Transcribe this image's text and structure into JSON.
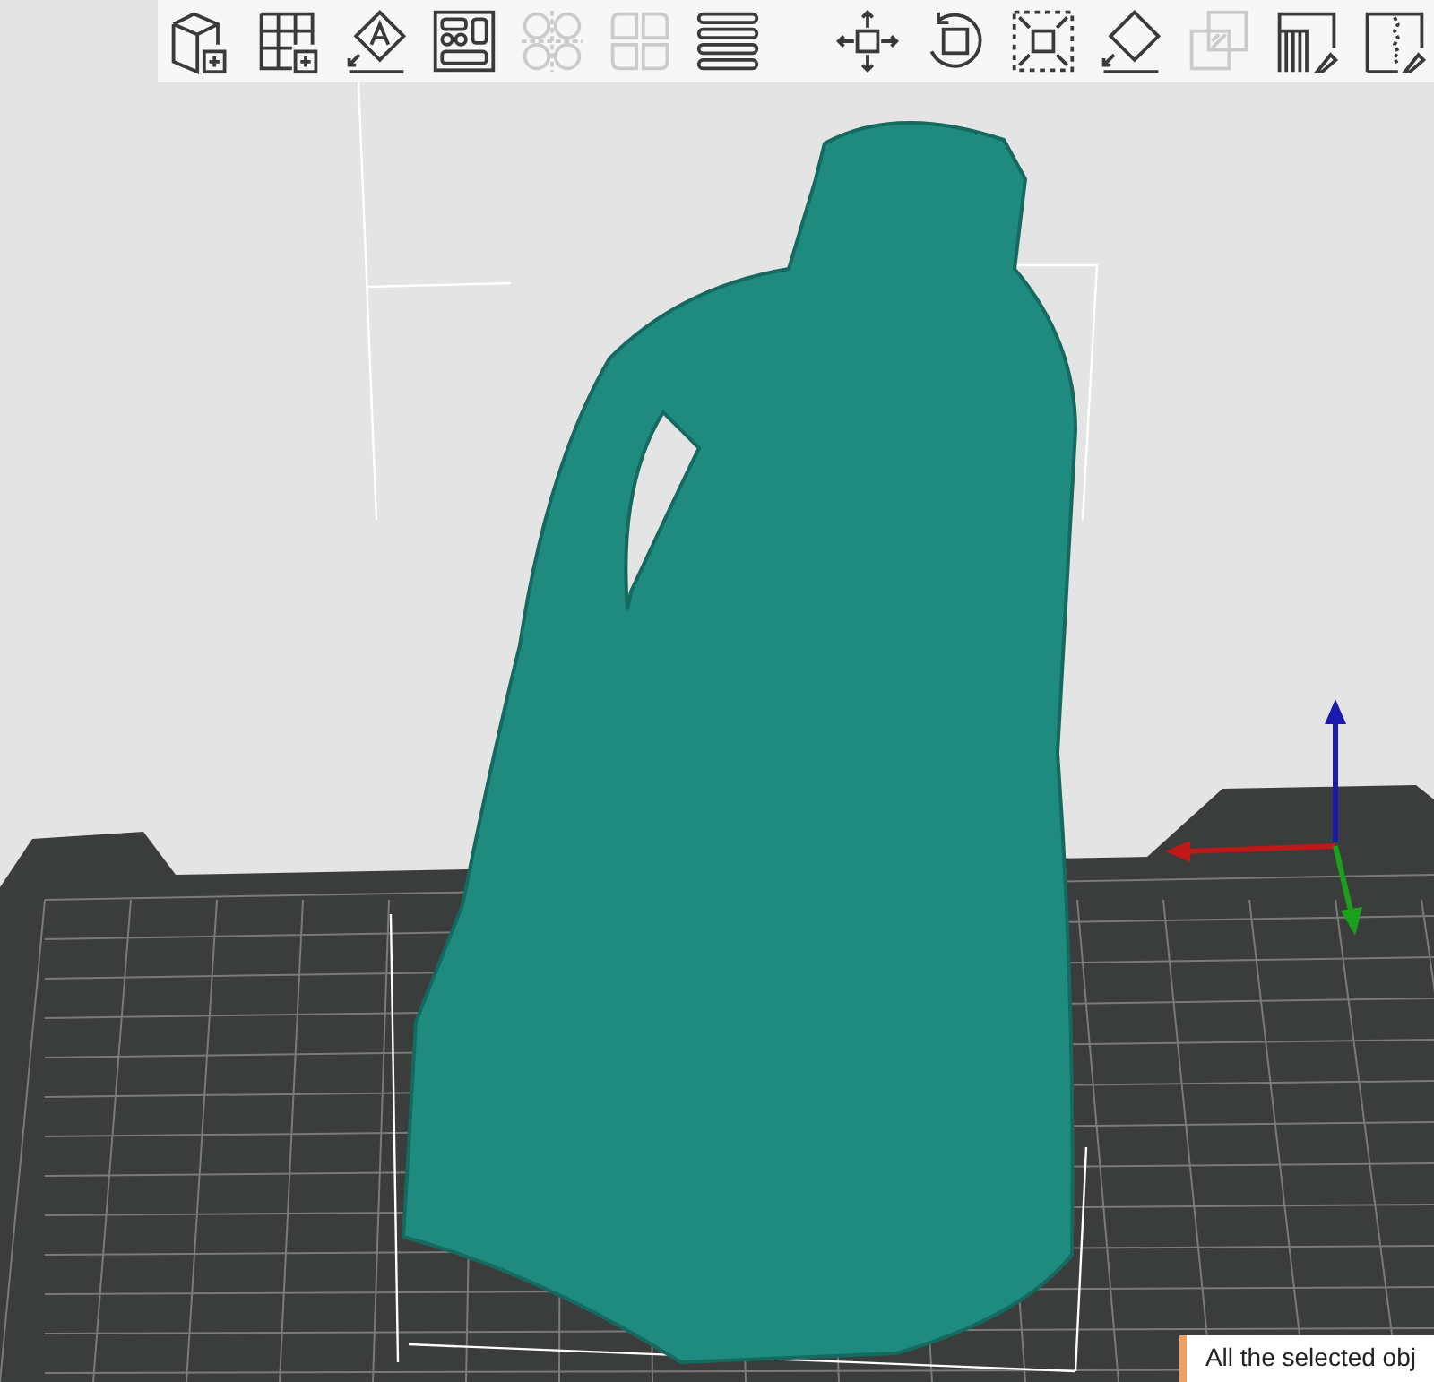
{
  "toolbar": {
    "tools": [
      {
        "kind": "add-cube",
        "disabled": false
      },
      {
        "kind": "add-grid",
        "disabled": false
      },
      {
        "kind": "auto-orient",
        "disabled": false
      },
      {
        "kind": "arrange",
        "disabled": false
      },
      {
        "kind": "split-objects",
        "disabled": true
      },
      {
        "kind": "split-parts",
        "disabled": true
      },
      {
        "kind": "layers",
        "disabled": false
      },
      {
        "kind": "separator"
      },
      {
        "kind": "move",
        "disabled": false
      },
      {
        "kind": "rotate",
        "disabled": false
      },
      {
        "kind": "scale",
        "disabled": false
      },
      {
        "kind": "lay-flat",
        "disabled": false
      },
      {
        "kind": "boolean",
        "disabled": true
      },
      {
        "kind": "support-paint",
        "disabled": false
      },
      {
        "kind": "seam-paint",
        "disabled": false
      }
    ]
  },
  "notification": {
    "text": "All the selected obj"
  }
}
